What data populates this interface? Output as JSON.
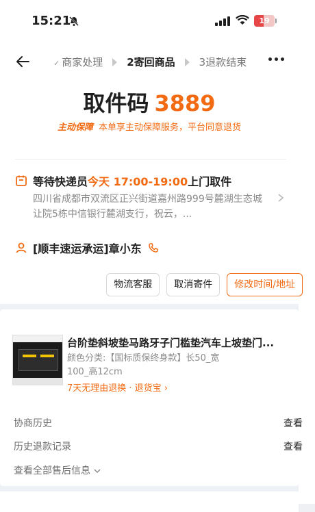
{
  "status_bar": {
    "time": "15:21",
    "battery": "19"
  },
  "header": {
    "steps": [
      {
        "label": "商家处理",
        "state": "done"
      },
      {
        "label": "2寄回商品",
        "state": "active"
      },
      {
        "label": "3退款结束",
        "state": "todo"
      }
    ]
  },
  "pickup": {
    "label": "取件码",
    "code": "3889",
    "guarantee_badge": "主动保障",
    "guarantee_text": "本单享主动保障服务，平台同意退货"
  },
  "pickup_info": {
    "wait_prefix": "等待快递员",
    "wait_time": "今天 17:00-19:00",
    "wait_suffix": "上门取件",
    "address": "四川省成都市双流区正兴街道嘉州路999号麓湖生态城让院5栋中信银行麓湖支行，祝云，..."
  },
  "courier": {
    "text": "[顺丰速运承运]章小东"
  },
  "actions": [
    {
      "label": "物流客服",
      "primary": false
    },
    {
      "label": "取消寄件",
      "primary": false
    },
    {
      "label": "修改时间/地址",
      "primary": true
    }
  ],
  "product": {
    "title": "台阶垫斜坡垫马路牙子门槛垫汽车上坡垫门...",
    "spec": "颜色分类:【国标质保终身款】长50_宽100_高12cm",
    "return_text": "7天无理由退换 · 退货宝 ›"
  },
  "history": [
    {
      "label": "协商历史",
      "action": "查看"
    },
    {
      "label": "历史退款记录",
      "action": "查看"
    }
  ],
  "all_after_sales": "查看全部售后信息",
  "colors": {
    "accent": "#f26a12"
  }
}
